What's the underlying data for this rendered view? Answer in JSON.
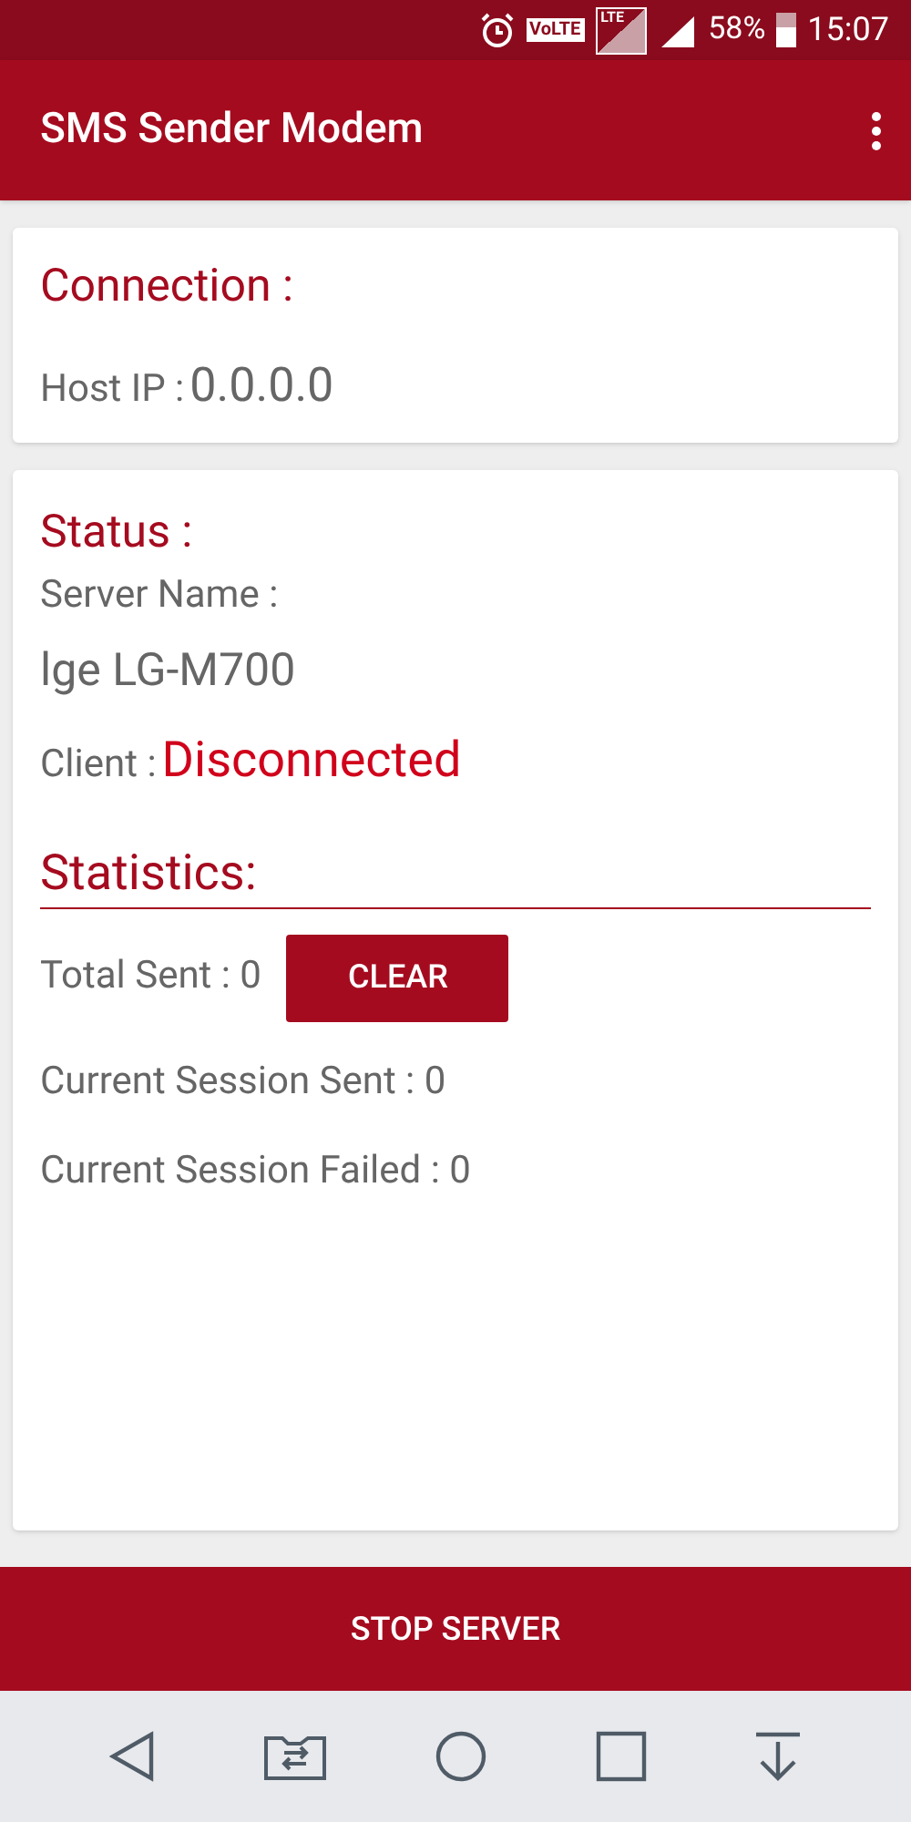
{
  "status_bar": {
    "volte": "VoLTE",
    "lte": "LTE",
    "battery_percent": "58%",
    "time": "15:07"
  },
  "app_bar": {
    "title": "SMS Sender Modem"
  },
  "connection": {
    "heading": "Connection :",
    "host_label": "Host IP :",
    "host_value": "0.0.0.0"
  },
  "status": {
    "heading": "Status :",
    "server_label": "Server Name :",
    "server_value": "lge LG-M700",
    "client_label": "Client :",
    "client_value": "Disconnected"
  },
  "statistics": {
    "heading": "Statistics:",
    "rows": [
      {
        "label": "Total Sent : 0",
        "button": "CLEAR"
      },
      {
        "label": "Current Session Sent : 0"
      },
      {
        "label": "Current Session Failed : 0"
      }
    ]
  },
  "stop_button": "STOP SERVER"
}
